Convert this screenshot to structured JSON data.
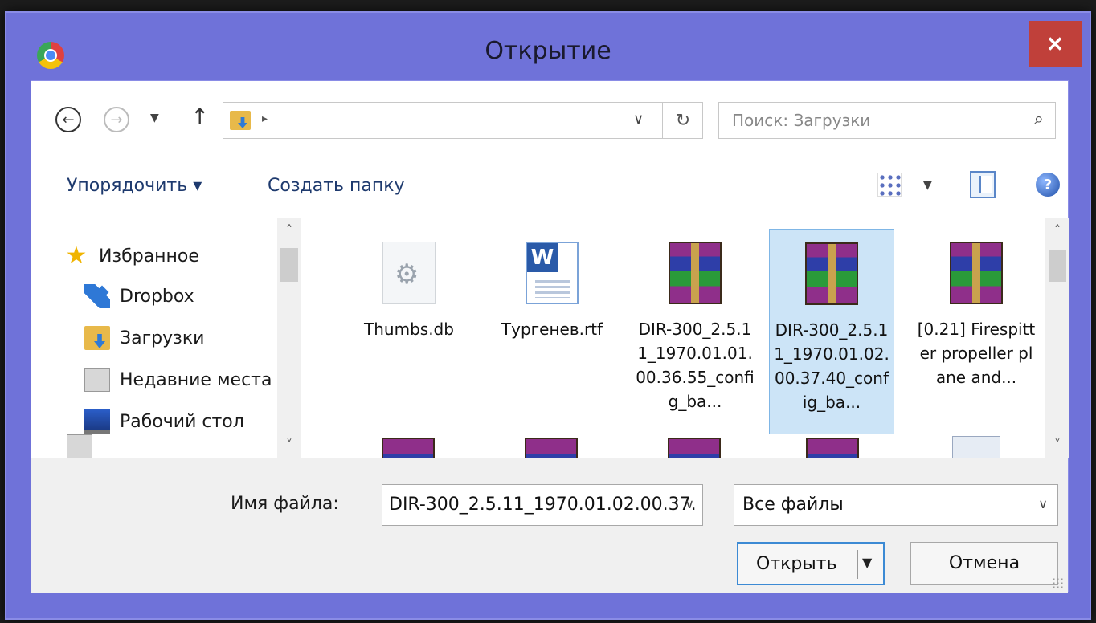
{
  "window": {
    "title": "Открытие",
    "close_label": "✕",
    "app_icon": "chrome-icon"
  },
  "address": {
    "back_glyph": "←",
    "forward_glyph": "→",
    "recent_glyph": "▼",
    "up_glyph": "↑",
    "path_chevron": "▸",
    "path_dropdown": "∨",
    "refresh_glyph": "↻",
    "search_placeholder": "Поиск: Загрузки",
    "search_glyph": "⌕"
  },
  "toolbar": {
    "organize_label": "Упорядочить ▾",
    "new_folder_label": "Создать папку",
    "view_dropdown": "▼",
    "help_glyph": "?"
  },
  "nav": {
    "items": [
      {
        "label": "Избранное",
        "icon": "star-icon"
      },
      {
        "label": "Dropbox",
        "icon": "dropbox-icon"
      },
      {
        "label": "Загрузки",
        "icon": "downloads-folder-icon"
      },
      {
        "label": "Недавние места",
        "icon": "recent-places-icon"
      },
      {
        "label": "Рабочий стол",
        "icon": "desktop-icon"
      }
    ],
    "scroll_up": "˄",
    "scroll_down": "˅"
  },
  "files": {
    "items": [
      {
        "name": "Thumbs.db",
        "icon": "system-file-icon",
        "selected": false
      },
      {
        "name": "Тургенев.rtf",
        "icon": "word-document-icon",
        "selected": false
      },
      {
        "name": "DIR-300_2.5.11_1970.01.01.00.36.55_config_ba...",
        "icon": "rar-archive-icon",
        "selected": false
      },
      {
        "name": "DIR-300_2.5.11_1970.01.02.00.37.40_config_ba...",
        "icon": "rar-archive-icon",
        "selected": true
      },
      {
        "name": "[0.21] Firespitter propeller plane and...",
        "icon": "rar-archive-icon",
        "selected": false
      }
    ],
    "scroll_up": "˄",
    "scroll_down": "˅"
  },
  "bottom": {
    "filename_label": "Имя файла:",
    "filename_value": "DIR-300_2.5.11_1970.01.02.00.37.",
    "filename_dropdown": "∨",
    "filetype_value": "Все файлы",
    "filetype_dropdown": "∨",
    "open_label": "Открыть",
    "open_arrow": "▼",
    "cancel_label": "Отмена"
  },
  "colors": {
    "window_frame": "#6f72d9",
    "close_button": "#c0403a",
    "selection": "#cce4f7",
    "link_text": "#1e3a6e"
  }
}
